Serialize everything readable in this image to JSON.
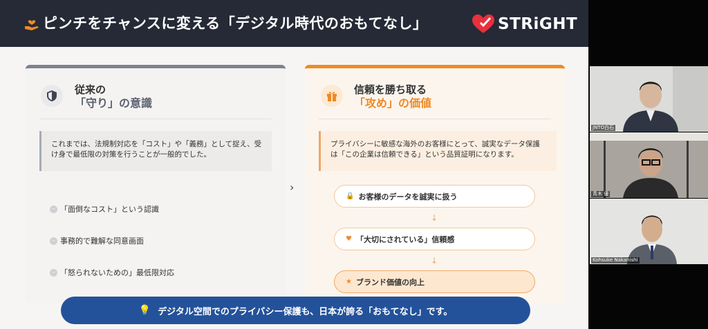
{
  "slide": {
    "title": "ピンチをチャンスに変える「デジタル時代のおもてなし」",
    "logo_text": "STRiGHT",
    "left_card": {
      "title_line1": "従来の",
      "title_line2": "「守り」の意識",
      "icon": "shield-icon",
      "quote": "これまでは、法規制対応を「コスト」や「義務」として捉え、受け身で最低限の対策を行うことが一般的でした。",
      "bullets": [
        "「面倒なコスト」という認識",
        "事務的で難解な同意画面",
        "「怒られないための」最低限対応"
      ]
    },
    "right_card": {
      "title_line1": "信頼を勝ち取る",
      "title_line2": "「攻め」の価値",
      "icon": "gift-icon",
      "quote": "プライバシーに敏感な海外のお客様にとって、誠実なデータ保護は「この企業は信頼できる」という品質証明になります。",
      "steps": [
        {
          "icon": "lock-icon",
          "label": "お客様のデータを誠実に扱う"
        },
        {
          "icon": "heart-icon",
          "label": "「大切にされている」信頼感"
        },
        {
          "icon": "star-icon",
          "label": "ブランド価値の向上"
        }
      ]
    },
    "banner": "デジタル空間でのプライバシー保護も、日本が誇る「おもてなし」です。",
    "colors": {
      "header": "#262a36",
      "accent_orange": "#f08a24",
      "accent_gray": "#7b8291",
      "banner": "#24529a"
    }
  },
  "participants": [
    {
      "label": "JNTO白石"
    },
    {
      "label": "青木 優"
    },
    {
      "label": "Kohsuke Nakanishi"
    }
  ]
}
